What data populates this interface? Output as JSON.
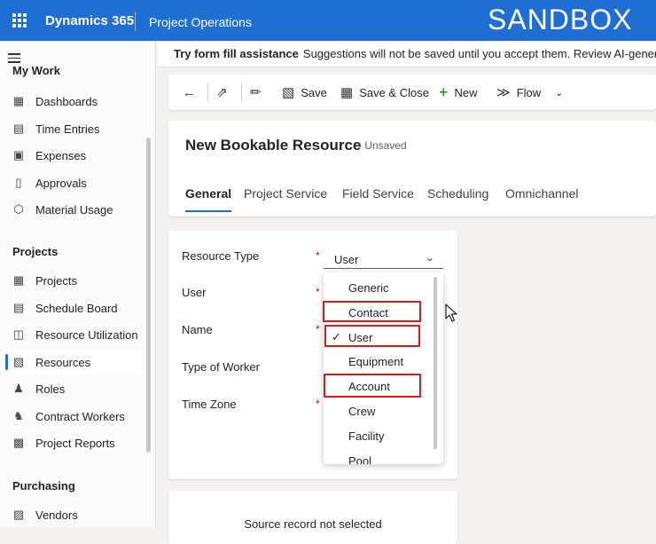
{
  "topbar": {
    "app_name": "Dynamics 365",
    "area": "Project Operations",
    "env_label": "SANDBOX"
  },
  "sidebar": {
    "section_mywork": "My Work",
    "mywork_items": [
      {
        "label": "Dashboards",
        "icon": "dashboard-icon"
      },
      {
        "label": "Time Entries",
        "icon": "calendar-icon"
      },
      {
        "label": "Expenses",
        "icon": "expense-icon"
      },
      {
        "label": "Approvals",
        "icon": "document-check-icon"
      },
      {
        "label": "Material Usage",
        "icon": "cube-icon"
      }
    ],
    "section_projects": "Projects",
    "project_items": [
      {
        "label": "Projects",
        "icon": "grid-icon"
      },
      {
        "label": "Schedule Board",
        "icon": "calendar-grid-icon"
      },
      {
        "label": "Resource Utilization",
        "icon": "chart-person-icon"
      },
      {
        "label": "Resources",
        "icon": "resource-icon",
        "selected": true
      },
      {
        "label": "Roles",
        "icon": "people-icon"
      },
      {
        "label": "Contract Workers",
        "icon": "contract-worker-icon"
      },
      {
        "label": "Project Reports",
        "icon": "report-icon"
      }
    ],
    "section_purchasing": "Purchasing",
    "purchasing_items": [
      {
        "label": "Vendors",
        "icon": "vendor-icon"
      }
    ]
  },
  "banner": {
    "title": "Try form fill assistance",
    "text": "Suggestions will not be saved until you accept them. Review AI-generated c"
  },
  "toolbar": {
    "save": "Save",
    "save_close": "Save & Close",
    "new": "New",
    "flow": "Flow"
  },
  "record": {
    "title": "New Bookable Resource",
    "status": "- Unsaved",
    "tabs": [
      "General",
      "Project Service",
      "Field Service",
      "Scheduling",
      "Omnichannel"
    ]
  },
  "form": {
    "fields": [
      {
        "label": "Resource Type",
        "required": true
      },
      {
        "label": "User",
        "required": true
      },
      {
        "label": "Name",
        "required": true
      },
      {
        "label": "Type of Worker",
        "required": false
      },
      {
        "label": "Time Zone",
        "required": true
      }
    ],
    "resource_type_value": "User",
    "options": [
      "Generic",
      "Contact",
      "User",
      "Equipment",
      "Account",
      "Crew",
      "Facility",
      "Pool"
    ],
    "selected_option": "User",
    "highlighted_options": [
      "Contact",
      "User",
      "Account"
    ]
  },
  "second_card": {
    "text": "Source record not selected"
  },
  "colors": {
    "brand": "#1f6ed4",
    "highlight": "#d71920",
    "required": "#c50f1f"
  }
}
